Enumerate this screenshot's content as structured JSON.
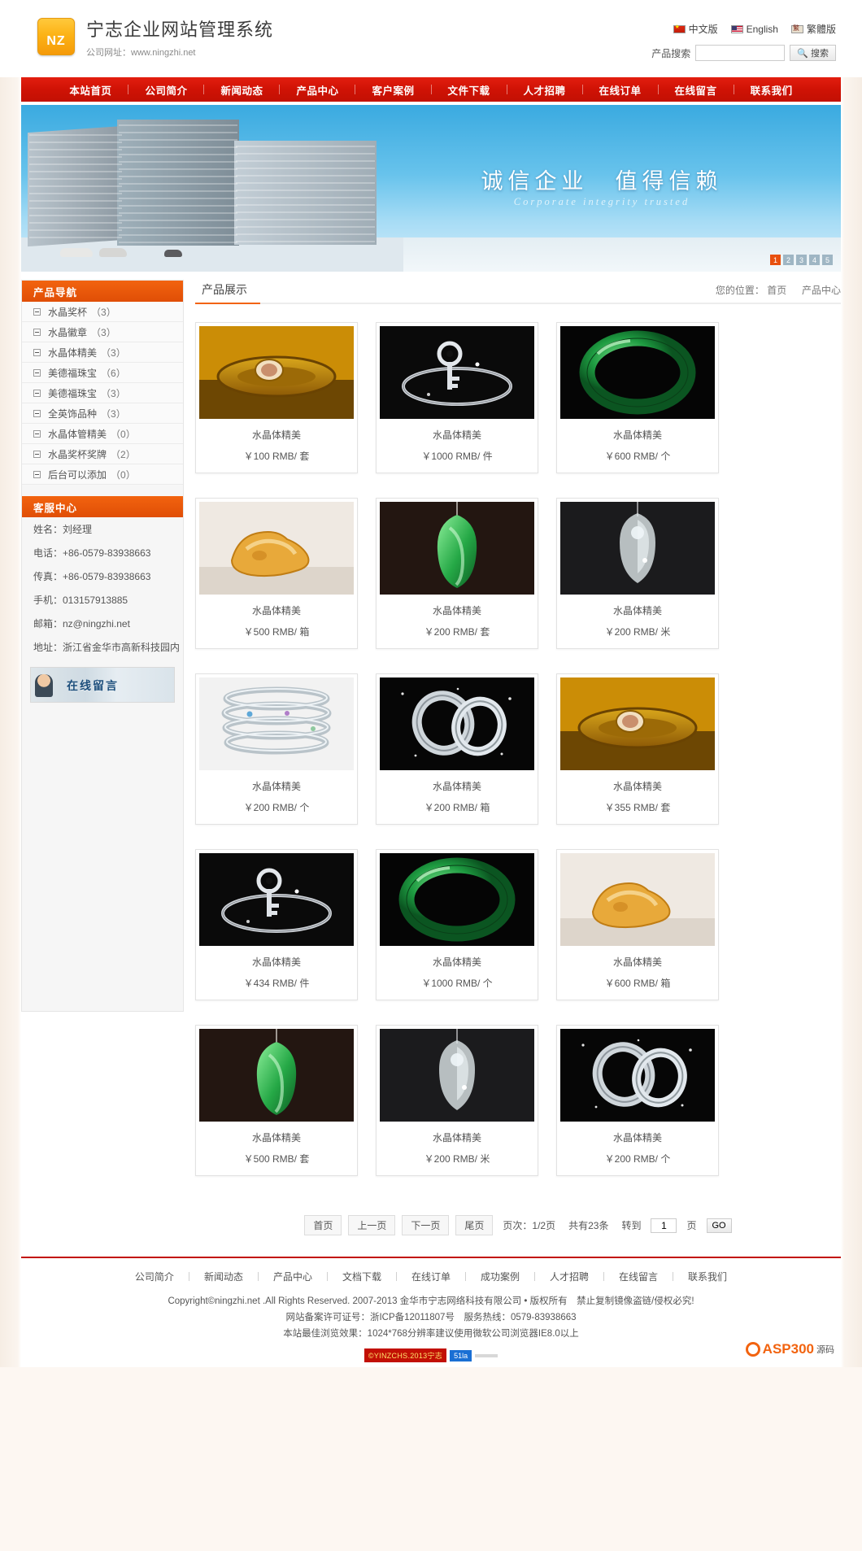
{
  "header": {
    "logo_mark": "NZ",
    "title": "宁志企业网站管理系统",
    "subtitle": "公司网址：www.ningzhi.net",
    "languages": [
      {
        "label": "中文版",
        "icon": "flag-cn-icon"
      },
      {
        "label": "English",
        "icon": "flag-us-icon"
      },
      {
        "label": "繁體版",
        "icon": "flag-tw-icon"
      }
    ],
    "search": {
      "label": "产品搜索",
      "value": "",
      "placeholder": "",
      "button_label": "搜索",
      "button_icon": "search-icon"
    }
  },
  "nav": {
    "items": [
      "本站首页",
      "公司简介",
      "新闻动态",
      "产品中心",
      "客户案例",
      "文件下载",
      "人才招聘",
      "在线订单",
      "在线留言",
      "联系我们"
    ]
  },
  "banner": {
    "title": "诚信企业　值得信赖",
    "subtitle": "Corporate integrity trusted",
    "dots": [
      "1",
      "2",
      "3",
      "4",
      "5"
    ],
    "active_dot": 0
  },
  "sidebar": {
    "product_nav": {
      "heading": "产品导航",
      "items": [
        {
          "label": "水晶奖杯",
          "count": "（3）"
        },
        {
          "label": "水晶徽章",
          "count": "（3）"
        },
        {
          "label": "水晶体精美",
          "count": "（3）"
        },
        {
          "label": "美德福珠宝",
          "count": "（6）"
        },
        {
          "label": "美德福珠宝",
          "count": "（3）"
        },
        {
          "label": "全英饰品种",
          "count": "（3）"
        },
        {
          "label": "水晶体管精美",
          "count": "（0）"
        },
        {
          "label": "水晶奖杯奖牌",
          "count": "（2）"
        },
        {
          "label": "后台可以添加",
          "count": "（0）"
        }
      ]
    },
    "service": {
      "heading": "客服中心",
      "lines": [
        "姓名：刘经理",
        "电话：+86-0579-83938663",
        "传真：+86-0579-83938663",
        "手机：013157913885",
        "邮箱：nz@ningzhi.net",
        "地址：浙江省金华市高新科技园内"
      ],
      "message_banner": "在线留言"
    }
  },
  "main": {
    "title": "产品展示",
    "breadcrumb_prefix": "您的位置：",
    "breadcrumb_home": "首页",
    "breadcrumb_sep": "　",
    "breadcrumb_current": "产品中心",
    "products": [
      {
        "name": "水晶体精美",
        "price": "￥100 RMB/ 套",
        "image": "gold-cameo-bangle"
      },
      {
        "name": "水晶体精美",
        "price": "￥1000 RMB/ 件",
        "image": "silver-key-pendant"
      },
      {
        "name": "水晶体精美",
        "price": "￥600 RMB/ 个",
        "image": "green-jade-bangle"
      },
      {
        "name": "水晶体精美",
        "price": "￥500 RMB/ 箱",
        "image": "amber-carving"
      },
      {
        "name": "水晶体精美",
        "price": "￥200 RMB/ 套",
        "image": "green-jade-pendant"
      },
      {
        "name": "水晶体精美",
        "price": "￥200 RMB/ 米",
        "image": "crystal-buddha"
      },
      {
        "name": "水晶体精美",
        "price": "￥200 RMB/ 个",
        "image": "stacked-silver-bangles"
      },
      {
        "name": "水晶体精美",
        "price": "￥200 RMB/ 箱",
        "image": "silver-rings-pair"
      },
      {
        "name": "水晶体精美",
        "price": "￥355 RMB/ 套",
        "image": "gold-cameo-bangle"
      },
      {
        "name": "水晶体精美",
        "price": "￥434 RMB/ 件",
        "image": "silver-key-pendant"
      },
      {
        "name": "水晶体精美",
        "price": "￥1000 RMB/ 个",
        "image": "green-jade-bangle"
      },
      {
        "name": "水晶体精美",
        "price": "￥600 RMB/ 箱",
        "image": "amber-carving"
      },
      {
        "name": "水晶体精美",
        "price": "￥500 RMB/ 套",
        "image": "green-jade-pendant"
      },
      {
        "name": "水晶体精美",
        "price": "￥200 RMB/ 米",
        "image": "crystal-buddha"
      },
      {
        "name": "水晶体精美",
        "price": "￥200 RMB/ 个",
        "image": "silver-rings-pair"
      }
    ],
    "pager": {
      "first": "首页",
      "prev": "上一页",
      "next": "下一页",
      "last": "尾页",
      "page_info": "页次：1/2页",
      "total": "共有23条",
      "goto_label": "转到",
      "goto_value": "1",
      "page_unit": "页",
      "go": "GO"
    }
  },
  "footer": {
    "nav": [
      "公司简介",
      "新闻动态",
      "产品中心",
      "文档下载",
      "在线订单",
      "成功案例",
      "人才招聘",
      "在线留言",
      "联系我们"
    ],
    "copyright": "Copyright©ningzhi.net .All Rights Reserved. 2007-2013 金华市宁志网络科技有限公司 • 版权所有　禁止复制镜像盗链/侵权必究!",
    "icp": "网站备案许可证号：浙ICP备12011807号　服务热线：0579-83938663",
    "browser": "本站最佳浏览效果：1024*768分辨率建议使用微软公司浏览器IE8.0以上",
    "badges": [
      "©YINZCHS.2013宁志",
      "51la",
      ""
    ],
    "brand_name": "ASP300",
    "brand_sub": "源码"
  }
}
